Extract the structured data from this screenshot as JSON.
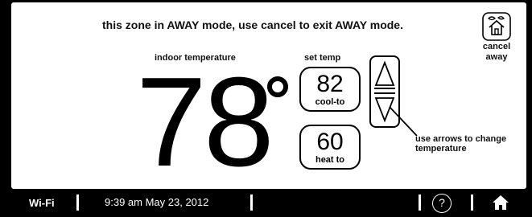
{
  "banner": {
    "text": "this zone in AWAY mode, use cancel to exit AWAY mode."
  },
  "cancel_away": {
    "line1": "cancel",
    "line2": "away",
    "icon": "away-house-icon"
  },
  "indoor": {
    "label": "indoor  temperature",
    "value": "78"
  },
  "set_temp": {
    "label": "set temp",
    "cool": {
      "value": "82",
      "label": "cool-to"
    },
    "heat": {
      "value": "60",
      "label": "heat to"
    }
  },
  "arrows_hint": {
    "line1": "use arrows to change",
    "line2": "temperature"
  },
  "status_bar": {
    "wifi": "Wi-Fi",
    "datetime": "9:39 am May 23, 2012",
    "help_symbol": "?",
    "home_icon": "home-icon"
  }
}
